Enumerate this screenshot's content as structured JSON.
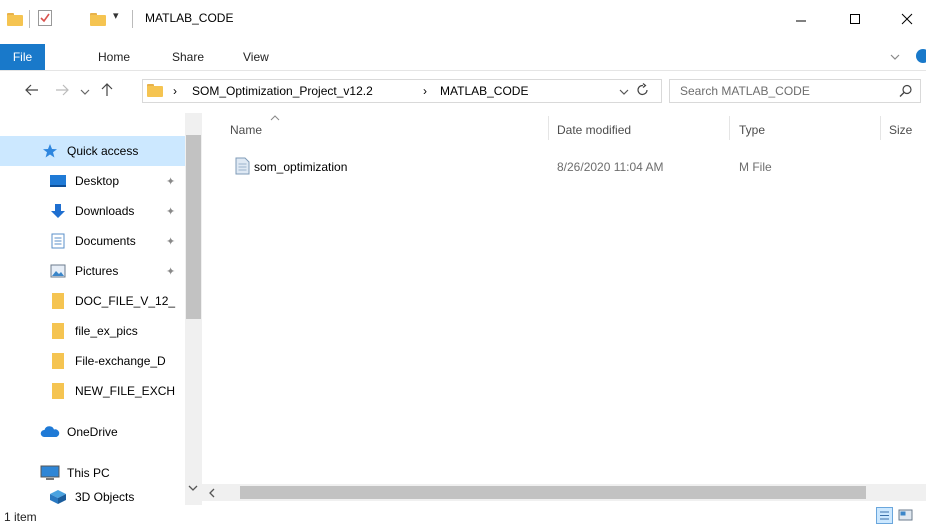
{
  "window": {
    "title": "MATLAB_CODE",
    "minimize_label": "—",
    "maximize_label": "☐",
    "close_label": "✕"
  },
  "ribbon": {
    "tabs": [
      "File",
      "Home",
      "Share",
      "View"
    ],
    "expand_label": "⌄"
  },
  "address": {
    "breadcrumb": [
      "SOM_Optimization_Project_v12.2",
      "MATLAB_CODE"
    ],
    "separator": "›",
    "dropdown_label": "⌄",
    "refresh_label": "↻"
  },
  "search": {
    "placeholder": "Search MATLAB_CODE",
    "icon": "⌕"
  },
  "nav": {
    "items": [
      {
        "label": "Quick access",
        "icon": "star-icon",
        "pinned": false,
        "selected": true
      },
      {
        "label": "Desktop",
        "icon": "desktop-icon",
        "pinned": true
      },
      {
        "label": "Downloads",
        "icon": "download-arrow-icon",
        "pinned": true
      },
      {
        "label": "Documents",
        "icon": "documents-icon",
        "pinned": true
      },
      {
        "label": "Pictures",
        "icon": "pictures-icon",
        "pinned": true
      },
      {
        "label": "DOC_FILE_V_12_",
        "icon": "folder-icon",
        "pinned": false
      },
      {
        "label": "file_ex_pics",
        "icon": "folder-icon",
        "pinned": false
      },
      {
        "label": "File-exchange_D",
        "icon": "folder-icon",
        "pinned": false
      },
      {
        "label": "NEW_FILE_EXCH",
        "icon": "folder-icon",
        "pinned": false
      },
      {
        "label": "OneDrive",
        "icon": "cloud-icon",
        "pinned": false
      },
      {
        "label": "This PC",
        "icon": "computer-icon",
        "pinned": false
      },
      {
        "label": "3D Objects",
        "icon": "cube-icon",
        "pinned": false
      }
    ],
    "pin_glyph": "📌"
  },
  "columns": [
    "Name",
    "Date modified",
    "Type",
    "Size"
  ],
  "files": [
    {
      "name": "som_optimization",
      "date_modified": "8/26/2020 11:04 AM",
      "type": "M File",
      "size": ""
    }
  ],
  "status": {
    "item_count": "1 item"
  },
  "colors": {
    "accent": "#1979ca",
    "selected": "#cce8ff",
    "folder": "#f5c451"
  }
}
